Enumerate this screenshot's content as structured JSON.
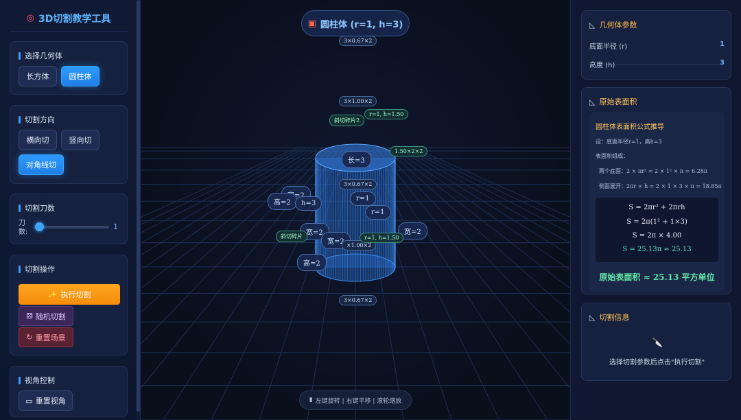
{
  "app": {
    "title": "3D切割教学工具"
  },
  "sidebar": {
    "shape": {
      "title": "选择几何体",
      "buttons": [
        "长方体",
        "圆柱体"
      ],
      "selected": "圆柱体"
    },
    "direction": {
      "title": "切割方向",
      "buttons": [
        "横向切",
        "竖向切",
        "对角线切"
      ],
      "selected": "对角线切"
    },
    "count": {
      "title": "切割刀数",
      "label": "刀数:",
      "value": "1",
      "fraction": 0.0
    },
    "ops": {
      "title": "切割操作",
      "execute": "执行切割",
      "random": "随机切割",
      "reset": "重置场景"
    },
    "view": {
      "title": "视角控制",
      "reset_view": "重置视角"
    }
  },
  "viewport": {
    "title": "圆柱体 (r=1, h=3)",
    "hint": "左键旋转 | 右键平移 | 滚轮缩放",
    "labels": {
      "top": "3×0.67×2",
      "a1": "3×1.00×2",
      "a2": "r=1, h=1.50",
      "a3": "斜切碎片2",
      "a4": "1.50×2×2",
      "a5": "长=3",
      "a6": "3×0.67×2",
      "a7": "宽=2",
      "a8": "高=2",
      "a9": "h=3",
      "a10": "r=1",
      "a11": "r=1",
      "a12": "宽=2",
      "a13": "宽=2",
      "a14": "斜切碎片",
      "a15": "宽=2",
      "a16": "×1.00×2",
      "a17": "r=1, h=1.50",
      "a18": "高=2",
      "bottom": "3×0.67×2"
    }
  },
  "right": {
    "params": {
      "title": "几何体参数",
      "radius_label": "底面半径 (r)",
      "radius": "1",
      "height_label": "高度 (h)",
      "height": "3"
    },
    "area": {
      "title": "原始表面积",
      "box_title": "圆柱体表面积公式推导",
      "lines": [
        "设：底面半径r=1，高h=3",
        "表面积组成：",
        "两个底面：2 × πr² = 2 × 1² × π = 6.28π",
        "侧面展开：2πr × h = 2 × 1 × 3 × π = 18.85π"
      ],
      "equations": [
        "S = 2πr² + 2πrh",
        "S = 2π(1² + 1×3)",
        "S = 2π × 4.00",
        "S = 25.13π ≈ 25.13"
      ],
      "result": "原始表面积 ≈ 25.13 平方单位"
    },
    "info": {
      "title": "切割信息",
      "message": "选择切割参数后点击\"执行切割\""
    }
  },
  "colors": {
    "accent": "#2e9bff",
    "orange": "#f7931a",
    "green": "#62e8a8",
    "wire": "#2f7fe0"
  }
}
